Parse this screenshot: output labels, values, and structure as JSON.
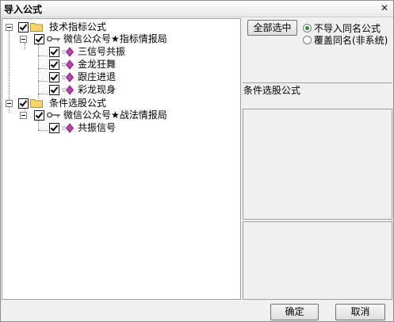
{
  "window": {
    "title": "导入公式",
    "close_glyph": "✕"
  },
  "tree": {
    "groups": [
      {
        "label": "技术指标公式",
        "children": [
          {
            "label": "微信公众号★指标情报局",
            "items": [
              "三信号共振",
              "金龙狂舞",
              "跟庄进退",
              "彩龙现身"
            ]
          }
        ]
      },
      {
        "label": "条件选股公式",
        "children": [
          {
            "label": "微信公众号★战法情报局",
            "items": [
              "共振信号"
            ]
          }
        ]
      }
    ]
  },
  "right": {
    "select_all_label": "全部选中",
    "option_no_import_same": "不导入同名公式",
    "option_overwrite_same": "覆盖同名(非系统)",
    "selected_option": "不导入同名公式",
    "panel_label": "条件选股公式"
  },
  "buttons": {
    "ok": "确定",
    "cancel": "取消"
  },
  "colors": {
    "folder": "#f7d66b",
    "gem": "#c03db0",
    "radio_on": "#1b9a1b"
  }
}
